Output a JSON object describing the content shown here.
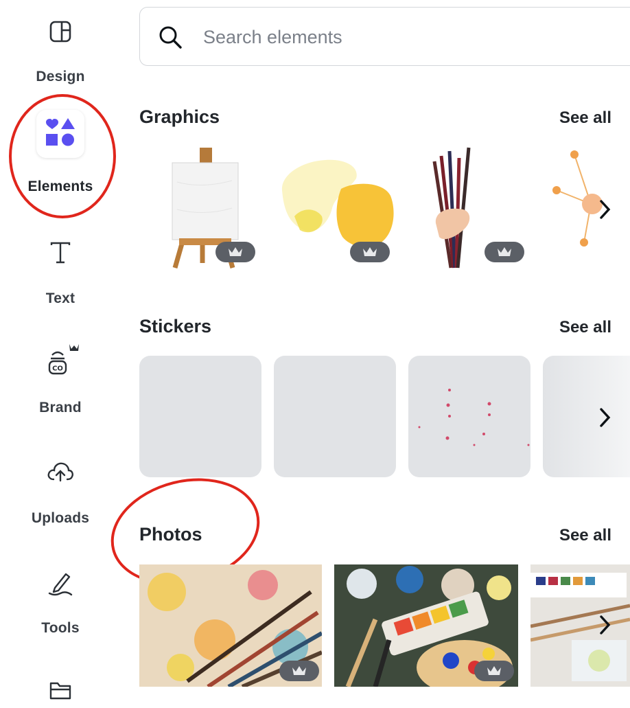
{
  "sidebar": {
    "items": [
      {
        "label": "Design",
        "icon": "layout-icon"
      },
      {
        "label": "Elements",
        "icon": "shapes-icon"
      },
      {
        "label": "Text",
        "icon": "text-icon"
      },
      {
        "label": "Brand",
        "icon": "brand-icon"
      },
      {
        "label": "Uploads",
        "icon": "cloud-upload-icon"
      },
      {
        "label": "Tools",
        "icon": "pen-icon"
      },
      {
        "label": "",
        "icon": "folder-icon"
      }
    ]
  },
  "search": {
    "placeholder": "Search elements"
  },
  "sections": {
    "graphics": {
      "title": "Graphics",
      "see_all": "See all"
    },
    "stickers": {
      "title": "Stickers",
      "see_all": "See all"
    },
    "photos": {
      "title": "Photos",
      "see_all": "See all"
    }
  },
  "colors": {
    "accent": "#6e5df1",
    "annotation": "#e0261c",
    "tile_bg": "#e1e3e6"
  }
}
